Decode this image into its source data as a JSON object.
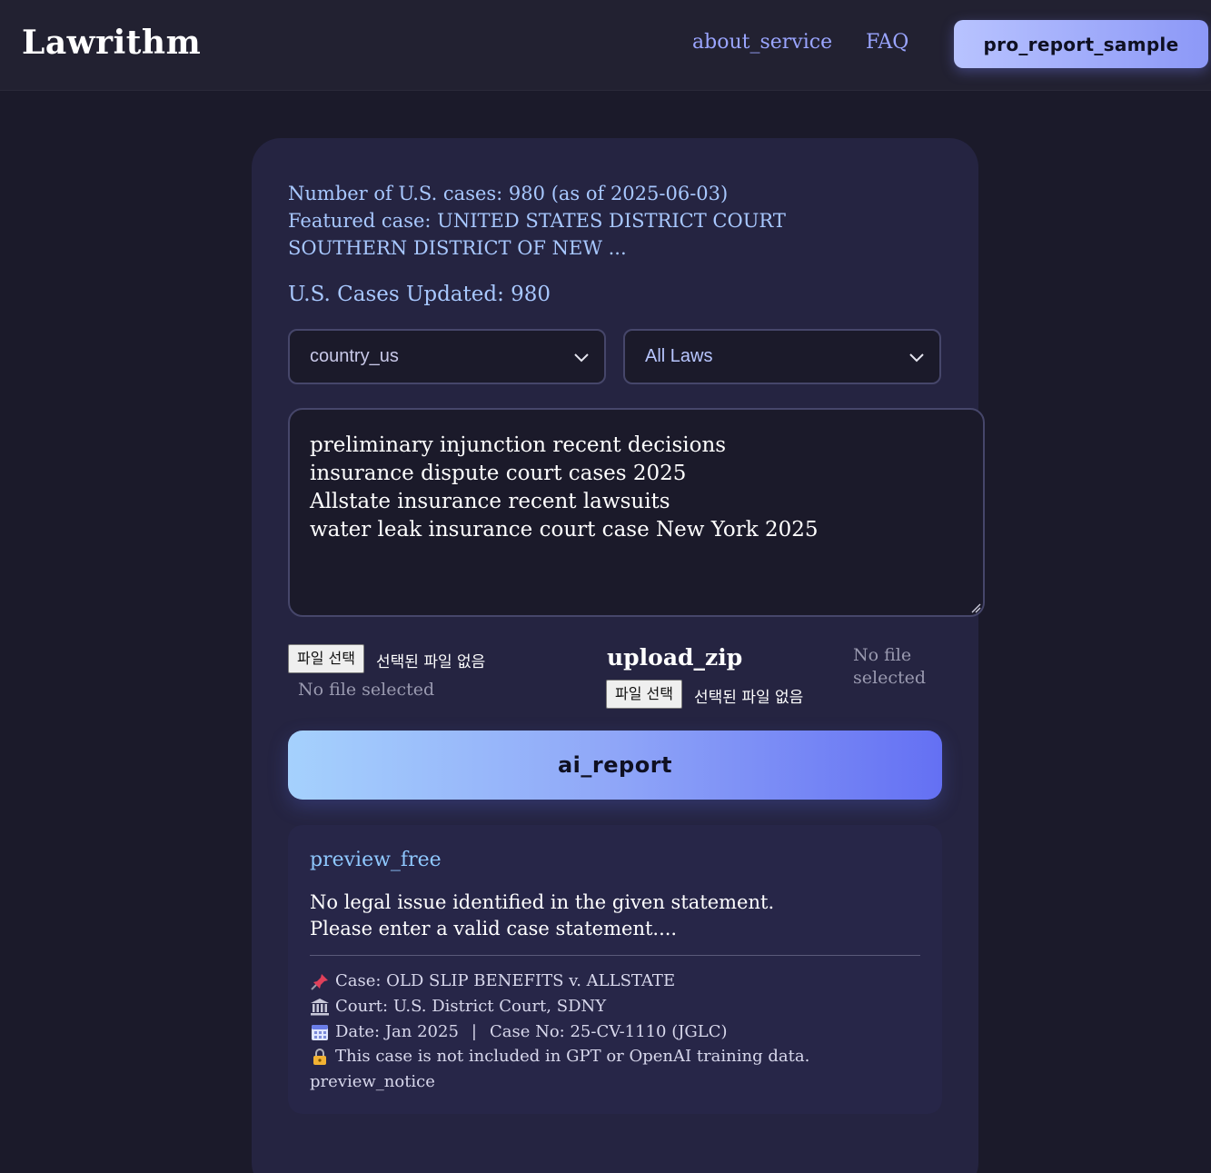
{
  "header": {
    "logo": "Lawrithm",
    "nav": {
      "about": "about_service",
      "faq": "FAQ"
    },
    "pro_button": "pro_report_sample"
  },
  "stats": {
    "count_line": "Number of U.S. cases: 980 (as of 2025-06-03)",
    "featured_line": "Featured case: UNITED STATES DISTRICT COURT SOUTHERN DISTRICT OF NEW ...",
    "updated_line": "U.S. Cases Updated: 980"
  },
  "filters": {
    "country_selected": "country_us",
    "law_selected": "All Laws"
  },
  "query": {
    "lines": [
      "preliminary injunction recent decisions",
      "insurance dispute court cases 2025",
      "Allstate insurance recent lawsuits",
      "water leak insurance court case New York 2025"
    ]
  },
  "uploads": {
    "choose_file_label": "파일 선택",
    "no_file_chosen": "선택된 파일 없음",
    "file_status": "No file selected",
    "zip_label": "upload_zip",
    "zip_status": "No file selected"
  },
  "ai_report_button": "ai_report",
  "preview": {
    "title": "preview_free",
    "message_line_1": "No legal issue identified in the given statement.",
    "message_line_2": "Please enter a valid case statement....",
    "case": "Case: OLD SLIP BENEFITS v. ALLSTATE",
    "court": "Court: U.S. District Court, SDNY",
    "date": "Date: Jan 2025",
    "case_no": "Case No: 25-CV-1110 (JGLC)",
    "separator": "|",
    "training_note": "This case is not included in GPT or OpenAI training data.",
    "notice": "preview_notice"
  },
  "icons": {
    "case": "pushpin-icon",
    "court": "classical-building-icon",
    "date": "calendar-icon",
    "training": "lock-icon",
    "select": "chevron-down-icon"
  },
  "colors": {
    "accent_link": "#9aa5ff",
    "info_text": "#a8c8ff",
    "card_bg": "#252441",
    "page_bg": "#1b1a2a"
  }
}
